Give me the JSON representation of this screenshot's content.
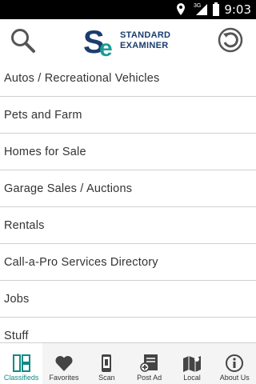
{
  "status_bar": {
    "time": "9:03",
    "network": "3G"
  },
  "header": {
    "logo": {
      "mark": "SE",
      "line1": "STANDARD",
      "line2": "EXAMINER"
    },
    "search_icon": "search-icon",
    "refresh_icon": "refresh-icon"
  },
  "categories": [
    "Autos / Recreational Vehicles",
    "Pets and Farm",
    "Homes for Sale",
    "Garage Sales / Auctions",
    "Rentals",
    "Call-a-Pro Services Directory",
    "Jobs",
    "Stuff"
  ],
  "tabs": [
    {
      "label": "Classifieds",
      "icon": "classifieds-icon",
      "active": true
    },
    {
      "label": "Favorites",
      "icon": "heart-icon",
      "active": false
    },
    {
      "label": "Scan",
      "icon": "scan-phone-icon",
      "active": false
    },
    {
      "label": "Post Ad",
      "icon": "post-ad-icon",
      "active": false
    },
    {
      "label": "Local",
      "icon": "map-icon",
      "active": false
    },
    {
      "label": "About Us",
      "icon": "info-icon",
      "active": false
    }
  ],
  "colors": {
    "accent": "#0e8a86",
    "brand": "#1a3d6e",
    "status_bar": "#000000"
  }
}
